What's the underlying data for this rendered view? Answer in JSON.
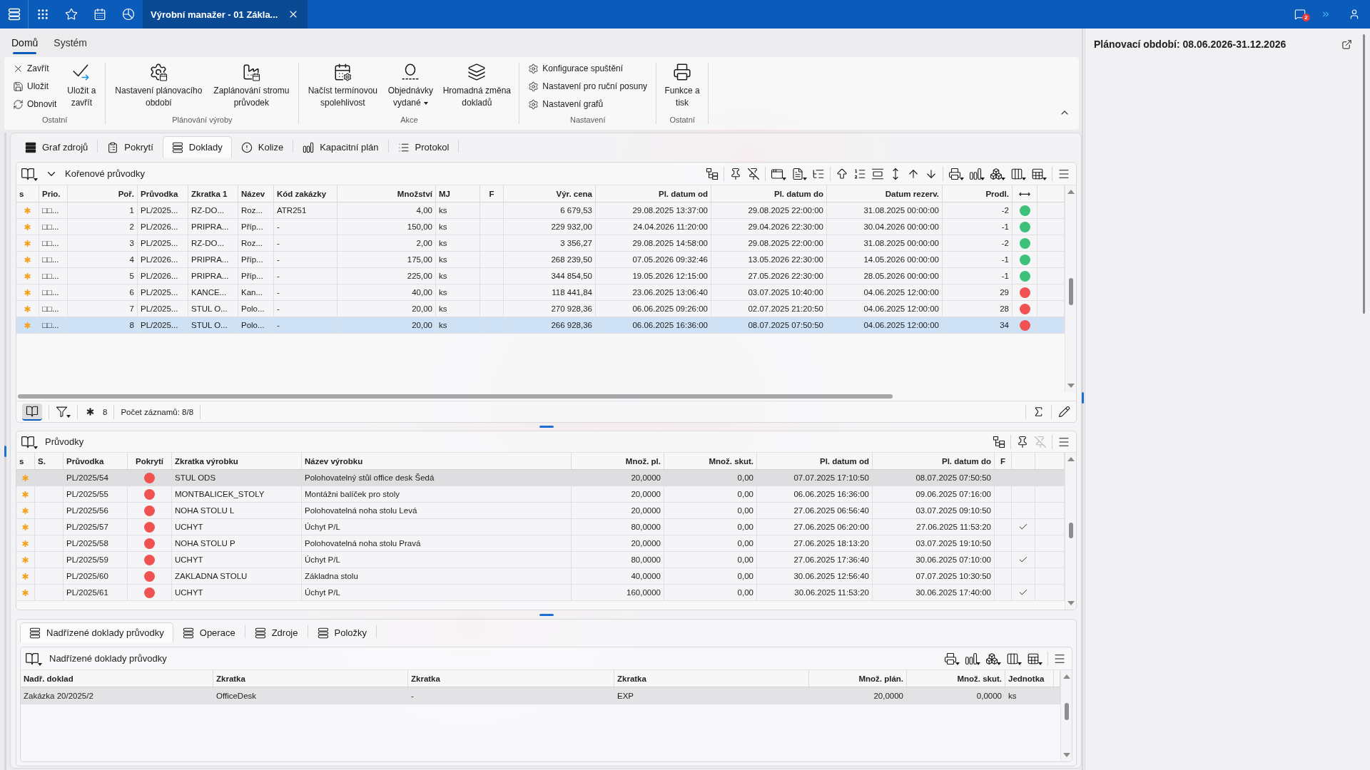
{
  "top_bar": {
    "document_tab": {
      "title": "Výrobní manažer - 01 Zákla...",
      "selected": true
    },
    "notification_badge": "2"
  },
  "ribbon": {
    "tabs": [
      {
        "label": "Domů",
        "selected": true
      },
      {
        "label": "Systém",
        "selected": false
      }
    ],
    "groups": [
      {
        "label": "Ostatní",
        "items": [
          {
            "kind": "small",
            "label": "Zavřít"
          },
          {
            "kind": "small",
            "label": "Uložit"
          },
          {
            "kind": "small",
            "label": "Obnovit"
          },
          {
            "kind": "large",
            "label": "Uložit a zavřít"
          }
        ]
      },
      {
        "label": "Plánování výroby",
        "items": [
          {
            "kind": "large",
            "label": "Nastavení plánovacího období"
          },
          {
            "kind": "large",
            "label": "Zaplánování stromu průvodek"
          }
        ]
      },
      {
        "label": "Akce",
        "items": [
          {
            "kind": "large",
            "label": "Načíst termínovou spolehlivost"
          },
          {
            "kind": "large",
            "label": "Objednávky vydané",
            "dropdown": true
          },
          {
            "kind": "large",
            "label": "Hromadná změna dokladů"
          }
        ]
      },
      {
        "label": "Nastavení",
        "items": [
          {
            "kind": "small",
            "label": "Konfigurace spuštění"
          },
          {
            "kind": "small",
            "label": "Nastavení pro ruční posuny"
          },
          {
            "kind": "small",
            "label": "Nastavení grafů"
          }
        ]
      },
      {
        "label": "Ostatní",
        "items": [
          {
            "kind": "large",
            "label": "Funkce a tisk"
          }
        ]
      }
    ]
  },
  "view_tabs": [
    {
      "label": "Graf zdrojů",
      "selected": false
    },
    {
      "label": "Pokrytí",
      "selected": false
    },
    {
      "label": "Doklady",
      "selected": true
    },
    {
      "label": "Kolize",
      "selected": false
    },
    {
      "label": "Kapacitní plán",
      "selected": false
    },
    {
      "label": "Protokol",
      "selected": false
    }
  ],
  "root_grid": {
    "title": "Kořenové průvodky",
    "columns": [
      "s",
      "Prio.",
      "Poř.",
      "Průvodka",
      "Zkratka 1",
      "Název",
      "Kód zakázky",
      "Množství",
      "MJ",
      "F",
      "Výr. cena",
      "Pl. datum od",
      "Pl. datum do",
      "Datum rezerv.",
      "Prodl.",
      "⟷"
    ],
    "rows": [
      {
        "prio": "□□...",
        "order": "1",
        "document": "PL/2025...",
        "abbr": "RZ-DO...",
        "name": "Roz...",
        "job_code": "ATR251",
        "quantity": "4,00",
        "unit": "ks",
        "price": "6 679,53",
        "date_from": "29.08.2025 13:37:00",
        "date_to": "29.08.2025 22:00:00",
        "reserved": "31.08.2025 00:00:00",
        "delay": "-2",
        "color": "#3dc07a",
        "selected": false
      },
      {
        "prio": "□□...",
        "order": "2",
        "document": "PL/2026...",
        "abbr": "PRIPRA...",
        "name": "Příp...",
        "job_code": "-",
        "quantity": "150,00",
        "unit": "ks",
        "price": "229 932,00",
        "date_from": "24.04.2026 11:20:00",
        "date_to": "29.04.2026 22:30:00",
        "reserved": "30.04.2026 00:00:00",
        "delay": "-1",
        "color": "#3dc07a",
        "selected": false
      },
      {
        "prio": "□□...",
        "order": "3",
        "document": "PL/2025...",
        "abbr": "RZ-DO...",
        "name": "Roz...",
        "job_code": "-",
        "quantity": "2,00",
        "unit": "ks",
        "price": "3 356,27",
        "date_from": "29.08.2025 14:58:00",
        "date_to": "29.08.2025 22:00:00",
        "reserved": "31.08.2025 00:00:00",
        "delay": "-2",
        "color": "#3dc07a",
        "selected": false
      },
      {
        "prio": "□□...",
        "order": "4",
        "document": "PL/2026...",
        "abbr": "PRIPRA...",
        "name": "Příp...",
        "job_code": "-",
        "quantity": "175,00",
        "unit": "ks",
        "price": "268 239,50",
        "date_from": "07.05.2026 09:32:46",
        "date_to": "13.05.2026 22:30:00",
        "reserved": "14.05.2026 00:00:00",
        "delay": "-1",
        "color": "#3dc07a",
        "selected": false
      },
      {
        "prio": "□□...",
        "order": "5",
        "document": "PL/2026...",
        "abbr": "PRIPRA...",
        "name": "Příp...",
        "job_code": "-",
        "quantity": "225,00",
        "unit": "ks",
        "price": "344 854,50",
        "date_from": "19.05.2026 12:15:00",
        "date_to": "27.05.2026 22:30:00",
        "reserved": "28.05.2026 00:00:00",
        "delay": "-1",
        "color": "#3dc07a",
        "selected": false
      },
      {
        "prio": "□□...",
        "order": "6",
        "document": "PL/2025...",
        "abbr": "KANCE...",
        "name": "Kan...",
        "job_code": "-",
        "quantity": "40,00",
        "unit": "ks",
        "price": "118 441,84",
        "date_from": "23.06.2025 13:06:40",
        "date_to": "03.07.2025 10:40:00",
        "reserved": "04.06.2025 12:00:00",
        "delay": "29",
        "color": "#f05252",
        "selected": false
      },
      {
        "prio": "□□...",
        "order": "7",
        "document": "PL/2025...",
        "abbr": "STUL O...",
        "name": "Polo...",
        "job_code": "-",
        "quantity": "20,00",
        "unit": "ks",
        "price": "270 928,36",
        "date_from": "06.06.2025 09:26:00",
        "date_to": "02.07.2025 21:20:50",
        "reserved": "04.06.2025 12:00:00",
        "delay": "28",
        "color": "#f05252",
        "selected": false
      },
      {
        "prio": "□□...",
        "order": "8",
        "document": "PL/2025...",
        "abbr": "STUL O...",
        "name": "Polo...",
        "job_code": "-",
        "quantity": "20,00",
        "unit": "ks",
        "price": "266 928,36",
        "date_from": "06.06.2025 16:36:00",
        "date_to": "08.07.2025 07:50:50",
        "reserved": "04.06.2025 12:00:00",
        "delay": "34",
        "color": "#f05252",
        "selected": true
      }
    ],
    "footer": {
      "view_on": true,
      "marked_count": "8",
      "record_count": "Počet záznamů: 8/8"
    }
  },
  "flow_grid": {
    "title": "Průvodky",
    "toolbar": {
      "unpin_disabled": true
    },
    "columns": [
      "s",
      "S.",
      "Průvodka",
      "Pokrytí",
      "Zkratka výrobku",
      "Název výrobku",
      "Množ. pl.",
      "Množ. skut.",
      "Pl. datum od",
      "Pl. datum do",
      "F"
    ],
    "rows": [
      {
        "document": "PL/2025/54",
        "color": "#f05252",
        "abbr": "STUL ODS",
        "name": "Polohovatelný stůl office desk Šedá",
        "qty_plan": "20,0000",
        "qty_done": "0,00",
        "date_from": "07.07.2025 17:10:50",
        "date_to": "08.07.2025 07:50:50",
        "checked": false,
        "selected": true
      },
      {
        "document": "PL/2025/55",
        "color": "#f05252",
        "abbr": "MONTBALICEK_STOLY",
        "name": "Montážni balíček pro stoly",
        "qty_plan": "20,0000",
        "qty_done": "0,00",
        "date_from": "06.06.2025 16:36:00",
        "date_to": "09.06.2025 07:16:00",
        "checked": false,
        "selected": false
      },
      {
        "document": "PL/2025/56",
        "color": "#f05252",
        "abbr": "NOHA STOLU L",
        "name": "Polohovatelná noha stolu Levá",
        "qty_plan": "20,0000",
        "qty_done": "0,00",
        "date_from": "27.06.2025 06:56:40",
        "date_to": "03.07.2025 09:10:50",
        "checked": false,
        "selected": false
      },
      {
        "document": "PL/2025/57",
        "color": "#f05252",
        "abbr": "UCHYT",
        "name": "Úchyt P/L",
        "qty_plan": "80,0000",
        "qty_done": "0,00",
        "date_from": "27.06.2025 06:20:00",
        "date_to": "27.06.2025 11:53:20",
        "checked": true,
        "selected": false
      },
      {
        "document": "PL/2025/58",
        "color": "#f05252",
        "abbr": "NOHA STOLU P",
        "name": "Polohovatelná noha stolu Pravá",
        "qty_plan": "20,0000",
        "qty_done": "0,00",
        "date_from": "27.06.2025 18:13:20",
        "date_to": "03.07.2025 19:10:50",
        "checked": false,
        "selected": false
      },
      {
        "document": "PL/2025/59",
        "color": "#f05252",
        "abbr": "UCHYT",
        "name": "Úchyt P/L",
        "qty_plan": "80,0000",
        "qty_done": "0,00",
        "date_from": "27.06.2025 17:36:40",
        "date_to": "30.06.2025 07:10:00",
        "checked": true,
        "selected": false
      },
      {
        "document": "PL/2025/60",
        "color": "#f05252",
        "abbr": "ZAKLADNA STOLU",
        "name": "Základna stolu",
        "qty_plan": "40,0000",
        "qty_done": "0,00",
        "date_from": "30.06.2025 12:56:40",
        "date_to": "07.07.2025 10:30:50",
        "checked": false,
        "selected": false
      },
      {
        "document": "PL/2025/61",
        "color": "#f05252",
        "abbr": "UCHYT",
        "name": "Úchyt P/L",
        "qty_plan": "160,0000",
        "qty_done": "0,00",
        "date_from": "30.06.2025 11:53:20",
        "date_to": "30.06.2025 17:40:00",
        "checked": true,
        "selected": false
      }
    ]
  },
  "detail_tabs": [
    {
      "label": "Nadřízené doklady průvodky",
      "selected": true
    },
    {
      "label": "Operace",
      "selected": false
    },
    {
      "label": "Zdroje",
      "selected": false
    },
    {
      "label": "Položky",
      "selected": false
    }
  ],
  "parent_grid": {
    "title": "Nadřízené doklady průvodky",
    "columns": [
      "Nadř. doklad",
      "Zkratka",
      "Zkratka",
      "Zkratka",
      "Množ. plán.",
      "Množ. skut.",
      "Jednotka"
    ],
    "rows": [
      {
        "cells": [
          "Zakázka 20/2025/2",
          "OfficeDesk",
          "-",
          "EXP",
          "20,0000",
          "0,0000",
          "ks"
        ],
        "selected": true
      }
    ]
  },
  "side_panel": {
    "title": "Plánovací období: 08.06.2026-31.12.2026"
  }
}
